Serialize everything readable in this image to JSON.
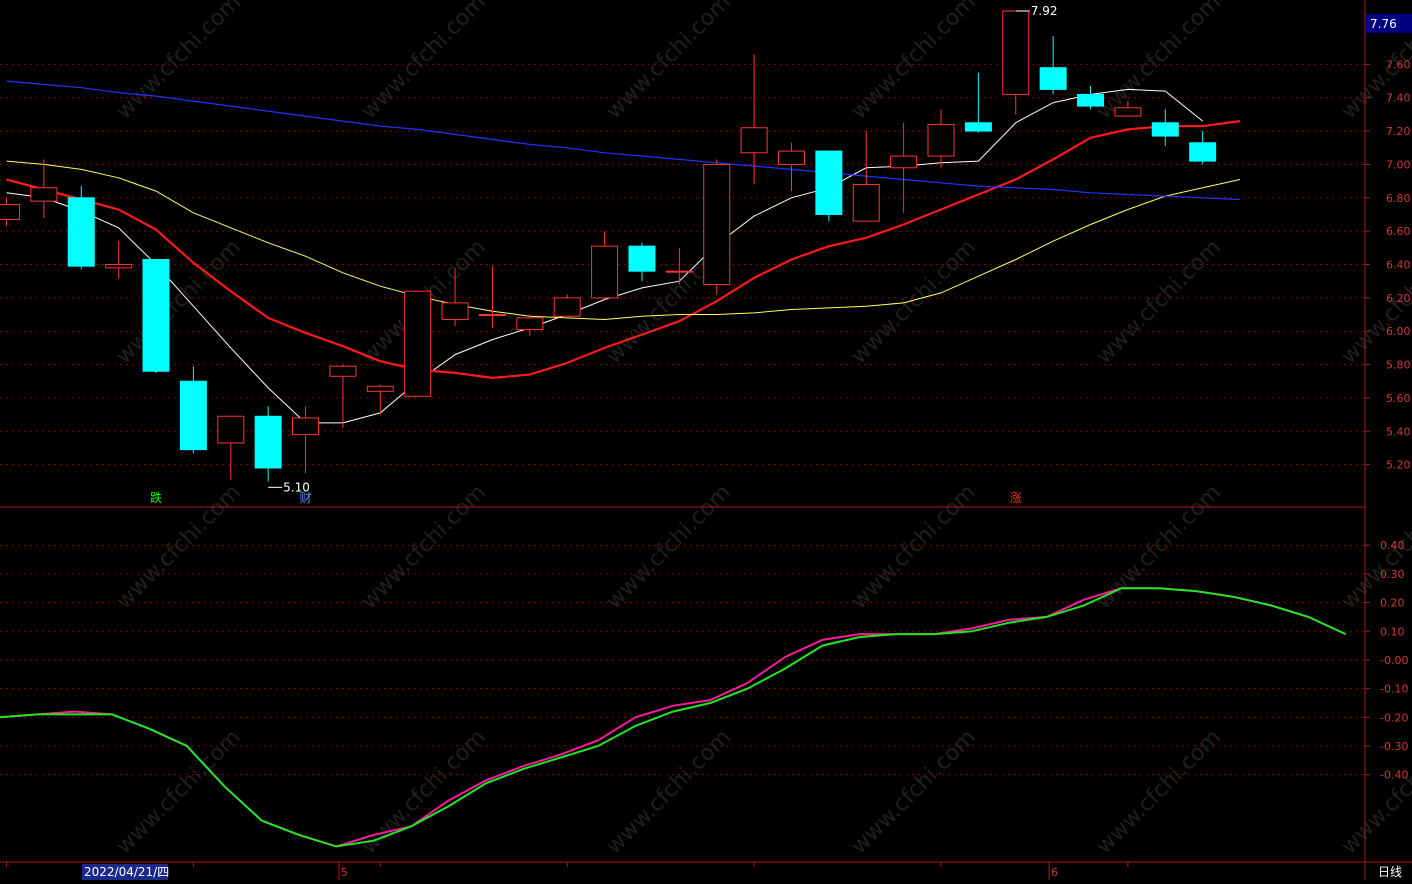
{
  "chart_data": [
    {
      "type": "candlestick",
      "name": "price-panel",
      "ylim": [
        5.0,
        7.95
      ],
      "yticks": [
        "7.60",
        "7.40",
        "7.20",
        "7.00",
        "6.80",
        "6.60",
        "6.40",
        "6.20",
        "6.00",
        "5.80",
        "5.60",
        "5.40",
        "5.20"
      ],
      "current_price_label": "7.76",
      "candles": [
        {
          "o": 6.67,
          "h": 6.8,
          "l": 6.63,
          "c": 6.76
        },
        {
          "o": 6.78,
          "h": 7.03,
          "l": 6.68,
          "c": 6.86
        },
        {
          "o": 6.8,
          "h": 6.87,
          "l": 6.37,
          "c": 6.39
        },
        {
          "o": 6.38,
          "h": 6.54,
          "l": 6.32,
          "c": 6.4
        },
        {
          "o": 6.43,
          "h": 6.43,
          "l": 5.75,
          "c": 5.76
        },
        {
          "o": 5.7,
          "h": 5.79,
          "l": 5.27,
          "c": 5.29
        },
        {
          "o": 5.33,
          "h": 5.49,
          "l": 5.11,
          "c": 5.49
        },
        {
          "o": 5.49,
          "h": 5.55,
          "l": 5.1,
          "c": 5.18
        },
        {
          "o": 5.38,
          "h": 5.55,
          "l": 5.15,
          "c": 5.48
        },
        {
          "o": 5.73,
          "h": 5.8,
          "l": 5.42,
          "c": 5.79
        },
        {
          "o": 5.64,
          "h": 5.68,
          "l": 5.5,
          "c": 5.67
        },
        {
          "o": 5.61,
          "h": 6.24,
          "l": 5.61,
          "c": 6.24
        },
        {
          "o": 6.07,
          "h": 6.38,
          "l": 6.03,
          "c": 6.17
        },
        {
          "o": 6.1,
          "h": 6.39,
          "l": 6.02,
          "c": 6.1
        },
        {
          "o": 6.01,
          "h": 6.1,
          "l": 5.97,
          "c": 6.08
        },
        {
          "o": 6.09,
          "h": 6.22,
          "l": 6.08,
          "c": 6.2
        },
        {
          "o": 6.2,
          "h": 6.6,
          "l": 6.19,
          "c": 6.51
        },
        {
          "o": 6.51,
          "h": 6.53,
          "l": 6.3,
          "c": 6.36
        },
        {
          "o": 6.36,
          "h": 6.5,
          "l": 6.28,
          "c": 6.36
        },
        {
          "o": 6.28,
          "h": 7.03,
          "l": 6.22,
          "c": 7.0
        },
        {
          "o": 7.07,
          "h": 7.66,
          "l": 6.88,
          "c": 7.22
        },
        {
          "o": 7.0,
          "h": 7.13,
          "l": 6.84,
          "c": 7.08
        },
        {
          "o": 7.08,
          "h": 7.08,
          "l": 6.66,
          "c": 6.7
        },
        {
          "o": 6.66,
          "h": 7.2,
          "l": 6.66,
          "c": 6.88
        },
        {
          "o": 6.98,
          "h": 7.25,
          "l": 6.71,
          "c": 7.05
        },
        {
          "o": 7.05,
          "h": 7.33,
          "l": 6.98,
          "c": 7.24
        },
        {
          "o": 7.25,
          "h": 7.55,
          "l": 7.19,
          "c": 7.2
        },
        {
          "o": 7.42,
          "h": 7.92,
          "l": 7.3,
          "c": 7.92
        },
        {
          "o": 7.58,
          "h": 7.77,
          "l": 7.42,
          "c": 7.45
        },
        {
          "o": 7.42,
          "h": 7.47,
          "l": 7.33,
          "c": 7.35
        },
        {
          "o": 7.29,
          "h": 7.38,
          "l": 7.29,
          "c": 7.34
        },
        {
          "o": 7.25,
          "h": 7.33,
          "l": 7.11,
          "c": 7.17
        },
        {
          "o": 7.13,
          "h": 7.2,
          "l": 7.0,
          "c": 7.02
        }
      ],
      "series": [
        {
          "values": [
            6.83,
            6.8,
            6.72,
            6.62,
            6.4,
            6.15,
            5.9,
            5.66,
            5.45,
            5.45,
            5.51,
            5.7,
            5.86,
            5.95,
            6.02,
            6.1,
            6.19,
            6.26,
            6.3,
            6.52,
            6.69,
            6.8,
            6.86,
            6.98,
            6.99,
            7.01,
            7.02,
            7.25,
            7.37,
            7.42,
            7.45,
            7.44,
            7.26
          ]
        },
        {
          "values": [
            6.91,
            6.85,
            6.79,
            6.73,
            6.61,
            6.41,
            6.24,
            6.08,
            5.99,
            5.91,
            5.82,
            5.77,
            5.75,
            5.72,
            5.74,
            5.81,
            5.9,
            5.98,
            6.06,
            6.18,
            6.32,
            6.43,
            6.51,
            6.56,
            6.64,
            6.73,
            6.82,
            6.91,
            7.03,
            7.16,
            7.21,
            7.23,
            7.23,
            7.26
          ]
        },
        {
          "values": [
            7.02,
            7.0,
            6.97,
            6.92,
            6.84,
            6.71,
            6.62,
            6.53,
            6.45,
            6.35,
            6.27,
            6.21,
            6.16,
            6.12,
            6.09,
            6.08,
            6.07,
            6.09,
            6.1,
            6.1,
            6.11,
            6.13,
            6.14,
            6.15,
            6.17,
            6.23,
            6.33,
            6.43,
            6.54,
            6.64,
            6.73,
            6.81,
            6.86,
            6.91
          ]
        },
        {
          "values": [
            7.5,
            7.48,
            7.46,
            7.43,
            7.41,
            7.38,
            7.35,
            7.32,
            7.29,
            7.26,
            7.23,
            7.21,
            7.18,
            7.15,
            7.12,
            7.1,
            7.07,
            7.05,
            7.03,
            7.01,
            6.99,
            6.97,
            6.95,
            6.93,
            6.91,
            6.89,
            6.87,
            6.86,
            6.85,
            6.83,
            6.82,
            6.81,
            6.8,
            6.79
          ]
        }
      ],
      "annotations": [
        {
          "text": "7.92",
          "candle": 27,
          "value": 7.92
        },
        {
          "text": "5.10",
          "candle": 7,
          "value": 5.1
        }
      ],
      "event_markers": [
        {
          "text": "跌",
          "candle": 4,
          "color": "#00ff00"
        },
        {
          "text": "财",
          "candle": 8,
          "color": "#5a8cff"
        },
        {
          "text": "涨",
          "candle": 27,
          "color": "#ff3030"
        }
      ]
    },
    {
      "type": "line",
      "name": "indicator-panel",
      "ylim": [
        -0.68,
        0.46
      ],
      "yticks": [
        "0.40",
        "0.30",
        "0.20",
        "0.10",
        "-0.00",
        "-0.10",
        "-0.20",
        "-0.30",
        "-0.40"
      ],
      "series": [
        {
          "color": "#ff1a9c",
          "values": [
            -0.2,
            -0.19,
            -0.18,
            -0.19,
            -0.24,
            -0.3,
            -0.44,
            -0.56,
            -0.61,
            -0.65,
            -0.61,
            -0.58,
            -0.49,
            -0.42,
            -0.37,
            -0.33,
            -0.28,
            -0.2,
            -0.16,
            -0.14,
            -0.08,
            0.01,
            0.07,
            0.09,
            0.09,
            0.09,
            0.11,
            0.14,
            0.15,
            0.21,
            0.25,
            0.25,
            0.24,
            0.22,
            0.19,
            0.15,
            0.09
          ]
        },
        {
          "color": "#22e622",
          "values": [
            -0.2,
            -0.19,
            -0.19,
            -0.19,
            -0.24,
            -0.3,
            -0.44,
            -0.56,
            -0.61,
            -0.65,
            -0.63,
            -0.58,
            -0.51,
            -0.43,
            -0.38,
            -0.34,
            -0.3,
            -0.23,
            -0.18,
            -0.15,
            -0.1,
            -0.03,
            0.05,
            0.08,
            0.09,
            0.09,
            0.1,
            0.13,
            0.15,
            0.19,
            0.25,
            0.25,
            0.24,
            0.22,
            0.19,
            0.15,
            0.09
          ]
        }
      ]
    }
  ],
  "xaxis": {
    "date_label": "2022/04/21/四",
    "month_marks": [
      {
        "text": "5",
        "candle": 9
      },
      {
        "text": "6",
        "candle": 28
      }
    ]
  },
  "period_label": "日线",
  "watermark": "www.cfchi.com",
  "colors": {
    "bull": "#ff3333",
    "bear": "#00ffff",
    "ma_white": "#ffffff",
    "ma_red": "#ff1a1a",
    "ma_yellow": "#ffff66",
    "ma_blue": "#2233ff",
    "grid": "#8b0000",
    "axis": "#b01a1a",
    "tick_text": "#d03838"
  }
}
